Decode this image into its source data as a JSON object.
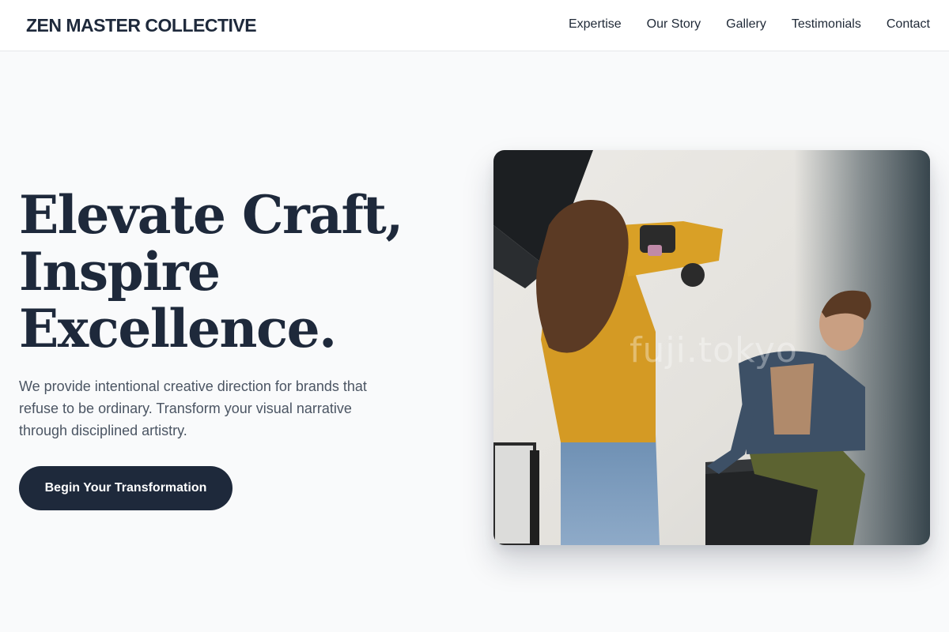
{
  "header": {
    "brand": "ZEN MASTER COLLECTIVE",
    "nav": [
      {
        "label": "Expertise"
      },
      {
        "label": "Our Story"
      },
      {
        "label": "Gallery"
      },
      {
        "label": "Testimonials"
      },
      {
        "label": "Contact"
      }
    ]
  },
  "hero": {
    "title_lines": [
      "Elevate Craft,",
      "Inspire",
      "Excellence."
    ],
    "subtitle": "We provide intentional creative direction for brands that refuse to be ordinary. Transform your visual narrative through disciplined artistry.",
    "cta_label": "Begin Your Transformation",
    "image": {
      "watermark": "fuji.tokyo"
    }
  },
  "colors": {
    "page_bg": "#f9fafb",
    "header_bg": "#ffffff",
    "primary": "#1e293b",
    "body_text": "#4b5563"
  }
}
